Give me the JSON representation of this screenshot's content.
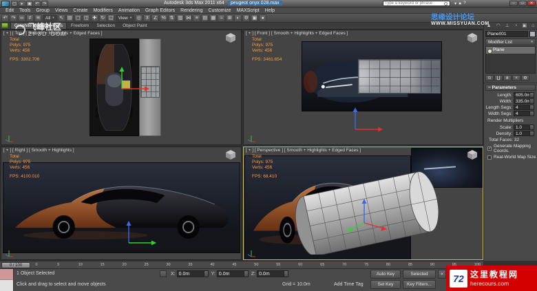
{
  "titlebar": {
    "app_title": "Autodesk 3ds Max 2011 x64",
    "file_name": "peugeot onyx 028.max",
    "search_placeholder": "Type a keyword or phrase",
    "window_min": "–",
    "window_max": "□",
    "window_close": "✕",
    "infocenter_icons": [
      {
        "name": "sign-in-icon",
        "glyph": "▾"
      },
      {
        "name": "favorites-icon",
        "glyph": "★"
      },
      {
        "name": "help-icon",
        "glyph": "?"
      }
    ]
  },
  "quick_access": [
    {
      "name": "new-scene-icon",
      "glyph": "▢"
    },
    {
      "name": "open-file-icon",
      "glyph": "▸"
    },
    {
      "name": "save-file-icon",
      "glyph": "▣"
    },
    {
      "name": "undo-qat-icon",
      "glyph": "↶"
    },
    {
      "name": "redo-qat-icon",
      "glyph": "↷"
    }
  ],
  "menus": [
    "Edit",
    "Tools",
    "Group",
    "Views",
    "Create",
    "Modifiers",
    "Animation",
    "Graph Editors",
    "Rendering",
    "Customize",
    "MAXScript",
    "Help"
  ],
  "toolbar": {
    "group_a": [
      {
        "name": "undo-icon",
        "glyph": "↶"
      },
      {
        "name": "redo-icon",
        "glyph": "↷"
      },
      {
        "name": "select-and-link-icon",
        "glyph": "∞"
      },
      {
        "name": "unlink-selection-icon",
        "glyph": "≠"
      },
      {
        "name": "bind-to-spacewarp-icon",
        "glyph": "≋"
      }
    ],
    "filter_label": "All",
    "group_b": [
      {
        "name": "select-object-icon",
        "glyph": "↖"
      },
      {
        "name": "select-by-name-icon",
        "glyph": "▤"
      },
      {
        "name": "rectangular-selection-region-icon",
        "glyph": "▢"
      },
      {
        "name": "window-crossing-icon",
        "glyph": "◫"
      },
      {
        "name": "select-and-move-icon",
        "glyph": "✚"
      },
      {
        "name": "select-and-rotate-icon",
        "glyph": "↻"
      },
      {
        "name": "select-and-scale-icon",
        "glyph": "◱"
      }
    ],
    "coord_label": "View",
    "group_c": [
      {
        "name": "use-pivot-center-icon",
        "glyph": "◎"
      },
      {
        "name": "snaps-toggle-icon",
        "glyph": "3"
      },
      {
        "name": "angle-snap-icon",
        "glyph": "∠"
      },
      {
        "name": "percent-snap-icon",
        "glyph": "%"
      },
      {
        "name": "spinner-snap-icon",
        "glyph": "⇅"
      },
      {
        "name": "edit-named-selections-icon",
        "glyph": "▥"
      },
      {
        "name": "mirror-icon",
        "glyph": "⋈"
      },
      {
        "name": "align-icon",
        "glyph": "≡"
      },
      {
        "name": "layer-manager-icon",
        "glyph": "▤"
      },
      {
        "name": "graphite-ribbon-toggle-icon",
        "glyph": "▦"
      },
      {
        "name": "curve-editor-icon",
        "glyph": "≈"
      },
      {
        "name": "schematic-view-icon",
        "glyph": "⊞"
      },
      {
        "name": "material-editor-icon",
        "glyph": "◐"
      },
      {
        "name": "render-setup-icon",
        "glyph": "⚙"
      },
      {
        "name": "rendered-frame-window-icon",
        "glyph": "▣"
      },
      {
        "name": "render-production-icon",
        "glyph": "●"
      }
    ]
  },
  "ribbon": {
    "tabs": [
      "Graphite Modeling Tools",
      "Freeform",
      "Selection",
      "Object Paint"
    ]
  },
  "viewports": {
    "top": {
      "label": "[ + ] [ Top ] [ Smooth + Highlights + Edged Faces ]",
      "stats": [
        "Total",
        "Polys: 975",
        "Verts: 456"
      ],
      "fps": "FPS: 3302.706"
    },
    "front": {
      "label": "[ + ] [ Front ] [ Smooth + Highlights + Edged Faces ]",
      "stats": [
        "Total",
        "Polys: 975",
        "Verts: 456"
      ],
      "fps": "FPS: 3461.654"
    },
    "right": {
      "label": "[ + ] [ Right ] [ Smooth + Highlights ]",
      "stats": [
        "Total",
        "Polys: 975",
        "Verts: 456"
      ],
      "fps": "FPS: 4100.010"
    },
    "perspective": {
      "label": "[ + ] [ Perspective ] [ Smooth + Highlights + Edged Faces ]",
      "stats": [
        "Total",
        "Polys: 975",
        "Verts: 456"
      ],
      "fps": "FPS: 68.410"
    }
  },
  "panel": {
    "tabs": [
      {
        "name": "create-tab",
        "glyph": "▲"
      },
      {
        "name": "modify-tab",
        "glyph": "◠"
      },
      {
        "name": "hierarchy-tab",
        "glyph": "⊥"
      },
      {
        "name": "motion-tab",
        "glyph": "◔"
      },
      {
        "name": "display-tab",
        "glyph": "▣"
      },
      {
        "name": "utilities-tab",
        "glyph": "⌂"
      }
    ],
    "object_name": "Plane001",
    "modifier_list": "Modifier List",
    "stack_item": "Plane",
    "stack_buttons": [
      {
        "name": "pin-stack-icon",
        "glyph": "⊙"
      },
      {
        "name": "show-end-result-icon",
        "glyph": "∐"
      },
      {
        "name": "make-unique-icon",
        "glyph": "⋔"
      },
      {
        "name": "remove-modifier-icon",
        "glyph": "×"
      },
      {
        "name": "configure-modifier-sets-icon",
        "glyph": "⚙"
      }
    ],
    "rollout_title": "Parameters",
    "params": [
      {
        "label": "Length:",
        "value": "605.0m"
      },
      {
        "label": "Width:",
        "value": "335.0m"
      },
      {
        "label": "Length Segs:",
        "value": "4"
      },
      {
        "label": "Width Segs:",
        "value": "4"
      }
    ],
    "rm_title": "Render Multipliers",
    "rm_params": [
      {
        "label": "Scale:",
        "value": "1.0"
      },
      {
        "label": "Density:",
        "value": "1.0"
      }
    ],
    "total_faces": "Total Faces: 32",
    "cb_mapping": "Generate Mapping Coords.",
    "cb_realworld": "Real-World Map Size"
  },
  "timeline": {
    "slider": "0 / 100",
    "ticks": [
      "0",
      "5",
      "10",
      "15",
      "20",
      "25",
      "30",
      "35",
      "40",
      "45",
      "50",
      "55",
      "60",
      "65",
      "70",
      "75",
      "80",
      "85",
      "90",
      "95",
      "100"
    ]
  },
  "status": {
    "selection": "1 Object Selected",
    "prompt": "Click and drag to select and move objects",
    "coords": [
      {
        "axis": "X:",
        "value": "0.0m"
      },
      {
        "axis": "Y:",
        "value": "0.0m"
      },
      {
        "axis": "Z:",
        "value": "0.0m"
      }
    ],
    "grid": "Grid = 10.0m",
    "time_tag": "Add Time Tag",
    "auto_key": "Auto Key",
    "set_key": "Set Key",
    "selected": "Selected",
    "key_filters": "Key Filters...",
    "playback": [
      {
        "name": "go-to-start-icon",
        "glyph": "«"
      },
      {
        "name": "previous-frame-icon",
        "glyph": "‹"
      },
      {
        "name": "play-animation-icon",
        "glyph": "►"
      }
    ]
  },
  "watermarks": {
    "zf3d": {
      "title": "飞峰社区",
      "sub": "ZF3D.COM"
    },
    "missyuan": {
      "title": "思缘设计论坛",
      "sub": "WWW.MISSYUAN.COM"
    },
    "here": {
      "logo": "72",
      "title": "这里教程网",
      "sub": "herecours.com"
    }
  }
}
